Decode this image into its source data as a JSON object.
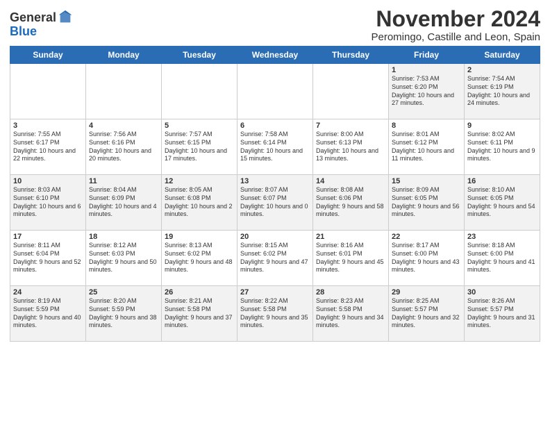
{
  "header": {
    "logo_general": "General",
    "logo_blue": "Blue",
    "month": "November 2024",
    "location": "Peromingo, Castille and Leon, Spain"
  },
  "days_of_week": [
    "Sunday",
    "Monday",
    "Tuesday",
    "Wednesday",
    "Thursday",
    "Friday",
    "Saturday"
  ],
  "weeks": [
    [
      {
        "day": "",
        "info": ""
      },
      {
        "day": "",
        "info": ""
      },
      {
        "day": "",
        "info": ""
      },
      {
        "day": "",
        "info": ""
      },
      {
        "day": "",
        "info": ""
      },
      {
        "day": "1",
        "info": "Sunrise: 7:53 AM\nSunset: 6:20 PM\nDaylight: 10 hours and 27 minutes."
      },
      {
        "day": "2",
        "info": "Sunrise: 7:54 AM\nSunset: 6:19 PM\nDaylight: 10 hours and 24 minutes."
      }
    ],
    [
      {
        "day": "3",
        "info": "Sunrise: 7:55 AM\nSunset: 6:17 PM\nDaylight: 10 hours and 22 minutes."
      },
      {
        "day": "4",
        "info": "Sunrise: 7:56 AM\nSunset: 6:16 PM\nDaylight: 10 hours and 20 minutes."
      },
      {
        "day": "5",
        "info": "Sunrise: 7:57 AM\nSunset: 6:15 PM\nDaylight: 10 hours and 17 minutes."
      },
      {
        "day": "6",
        "info": "Sunrise: 7:58 AM\nSunset: 6:14 PM\nDaylight: 10 hours and 15 minutes."
      },
      {
        "day": "7",
        "info": "Sunrise: 8:00 AM\nSunset: 6:13 PM\nDaylight: 10 hours and 13 minutes."
      },
      {
        "day": "8",
        "info": "Sunrise: 8:01 AM\nSunset: 6:12 PM\nDaylight: 10 hours and 11 minutes."
      },
      {
        "day": "9",
        "info": "Sunrise: 8:02 AM\nSunset: 6:11 PM\nDaylight: 10 hours and 9 minutes."
      }
    ],
    [
      {
        "day": "10",
        "info": "Sunrise: 8:03 AM\nSunset: 6:10 PM\nDaylight: 10 hours and 6 minutes."
      },
      {
        "day": "11",
        "info": "Sunrise: 8:04 AM\nSunset: 6:09 PM\nDaylight: 10 hours and 4 minutes."
      },
      {
        "day": "12",
        "info": "Sunrise: 8:05 AM\nSunset: 6:08 PM\nDaylight: 10 hours and 2 minutes."
      },
      {
        "day": "13",
        "info": "Sunrise: 8:07 AM\nSunset: 6:07 PM\nDaylight: 10 hours and 0 minutes."
      },
      {
        "day": "14",
        "info": "Sunrise: 8:08 AM\nSunset: 6:06 PM\nDaylight: 9 hours and 58 minutes."
      },
      {
        "day": "15",
        "info": "Sunrise: 8:09 AM\nSunset: 6:05 PM\nDaylight: 9 hours and 56 minutes."
      },
      {
        "day": "16",
        "info": "Sunrise: 8:10 AM\nSunset: 6:05 PM\nDaylight: 9 hours and 54 minutes."
      }
    ],
    [
      {
        "day": "17",
        "info": "Sunrise: 8:11 AM\nSunset: 6:04 PM\nDaylight: 9 hours and 52 minutes."
      },
      {
        "day": "18",
        "info": "Sunrise: 8:12 AM\nSunset: 6:03 PM\nDaylight: 9 hours and 50 minutes."
      },
      {
        "day": "19",
        "info": "Sunrise: 8:13 AM\nSunset: 6:02 PM\nDaylight: 9 hours and 48 minutes."
      },
      {
        "day": "20",
        "info": "Sunrise: 8:15 AM\nSunset: 6:02 PM\nDaylight: 9 hours and 47 minutes."
      },
      {
        "day": "21",
        "info": "Sunrise: 8:16 AM\nSunset: 6:01 PM\nDaylight: 9 hours and 45 minutes."
      },
      {
        "day": "22",
        "info": "Sunrise: 8:17 AM\nSunset: 6:00 PM\nDaylight: 9 hours and 43 minutes."
      },
      {
        "day": "23",
        "info": "Sunrise: 8:18 AM\nSunset: 6:00 PM\nDaylight: 9 hours and 41 minutes."
      }
    ],
    [
      {
        "day": "24",
        "info": "Sunrise: 8:19 AM\nSunset: 5:59 PM\nDaylight: 9 hours and 40 minutes."
      },
      {
        "day": "25",
        "info": "Sunrise: 8:20 AM\nSunset: 5:59 PM\nDaylight: 9 hours and 38 minutes."
      },
      {
        "day": "26",
        "info": "Sunrise: 8:21 AM\nSunset: 5:58 PM\nDaylight: 9 hours and 37 minutes."
      },
      {
        "day": "27",
        "info": "Sunrise: 8:22 AM\nSunset: 5:58 PM\nDaylight: 9 hours and 35 minutes."
      },
      {
        "day": "28",
        "info": "Sunrise: 8:23 AM\nSunset: 5:58 PM\nDaylight: 9 hours and 34 minutes."
      },
      {
        "day": "29",
        "info": "Sunrise: 8:25 AM\nSunset: 5:57 PM\nDaylight: 9 hours and 32 minutes."
      },
      {
        "day": "30",
        "info": "Sunrise: 8:26 AM\nSunset: 5:57 PM\nDaylight: 9 hours and 31 minutes."
      }
    ]
  ]
}
